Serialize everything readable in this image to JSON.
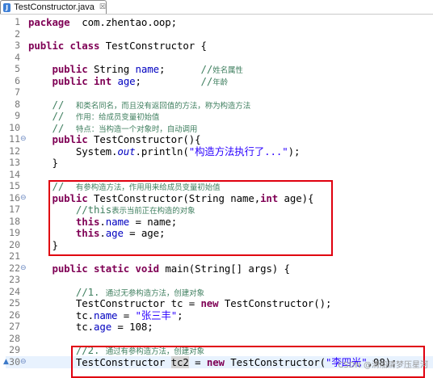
{
  "tab": {
    "title": "TestConstructor.java",
    "close_glyph": "☒"
  },
  "lines": [
    {
      "n": "1",
      "segs": [
        [
          "kw",
          "package"
        ],
        [
          "",
          "  com.zhentao.oop;"
        ]
      ]
    },
    {
      "n": "2",
      "segs": []
    },
    {
      "n": "3",
      "segs": [
        [
          "kw",
          "public"
        ],
        [
          "",
          ""
        ],
        [
          "kw",
          " class"
        ],
        [
          "",
          " TestConstructor {"
        ]
      ]
    },
    {
      "n": "4",
      "segs": []
    },
    {
      "n": "5",
      "segs": [
        [
          "",
          "    "
        ],
        [
          "kw",
          "public"
        ],
        [
          "",
          " String "
        ],
        [
          "field",
          "name"
        ],
        [
          "",
          ";      "
        ],
        [
          "cmm",
          "//"
        ],
        [
          "cm",
          "姓名属性"
        ]
      ]
    },
    {
      "n": "6",
      "segs": [
        [
          "",
          "    "
        ],
        [
          "kw",
          "public"
        ],
        [
          "kw",
          " int"
        ],
        [
          "",
          " "
        ],
        [
          "field",
          "age"
        ],
        [
          "",
          ";          "
        ],
        [
          "cmm",
          "//"
        ],
        [
          "cm",
          "年龄"
        ]
      ]
    },
    {
      "n": "7",
      "segs": []
    },
    {
      "n": "8",
      "segs": [
        [
          "",
          "    "
        ],
        [
          "cmm",
          "//  "
        ],
        [
          "cm",
          "和类名同名，而且没有返回值的方法，称为构造方法"
        ]
      ]
    },
    {
      "n": "9",
      "segs": [
        [
          "",
          "    "
        ],
        [
          "cmm",
          "//  "
        ],
        [
          "cm",
          "作用：给成员变量初始值"
        ]
      ]
    },
    {
      "n": "10",
      "segs": [
        [
          "",
          "    "
        ],
        [
          "cmm",
          "//  "
        ],
        [
          "cm",
          "特点：当构造一个对象时，自动调用"
        ]
      ]
    },
    {
      "n": "11",
      "fold": true,
      "segs": [
        [
          "",
          "    "
        ],
        [
          "kw",
          "public"
        ],
        [
          "",
          " TestConstructor(){"
        ]
      ]
    },
    {
      "n": "12",
      "segs": [
        [
          "",
          "        System."
        ],
        [
          "field it",
          "out"
        ],
        [
          "",
          ".println("
        ],
        [
          "str",
          "\"构造方法执行了...\""
        ],
        [
          "",
          ");"
        ]
      ]
    },
    {
      "n": "13",
      "segs": [
        [
          "",
          "    }"
        ]
      ]
    },
    {
      "n": "14",
      "segs": []
    },
    {
      "n": "15",
      "segs": [
        [
          "",
          "    "
        ],
        [
          "cmm",
          "//  "
        ],
        [
          "cm",
          "有参构造方法，作用用来给成员变量初始值"
        ]
      ]
    },
    {
      "n": "16",
      "fold": true,
      "segs": [
        [
          "",
          "    "
        ],
        [
          "kw",
          "public"
        ],
        [
          "",
          " TestConstructor(String name,"
        ],
        [
          "kw",
          "int"
        ],
        [
          "",
          " age){"
        ]
      ]
    },
    {
      "n": "17",
      "segs": [
        [
          "",
          "        "
        ],
        [
          "cmm",
          "//this"
        ],
        [
          "cm",
          "表示当前正在构造的对象"
        ]
      ]
    },
    {
      "n": "18",
      "segs": [
        [
          "",
          "        "
        ],
        [
          "kw",
          "this"
        ],
        [
          "",
          "."
        ],
        [
          "field",
          "name"
        ],
        [
          "",
          " = name;"
        ]
      ]
    },
    {
      "n": "19",
      "segs": [
        [
          "",
          "        "
        ],
        [
          "kw",
          "this"
        ],
        [
          "",
          "."
        ],
        [
          "field",
          "age"
        ],
        [
          "",
          " = age;"
        ]
      ]
    },
    {
      "n": "20",
      "segs": [
        [
          "",
          "    }"
        ]
      ]
    },
    {
      "n": "21",
      "segs": []
    },
    {
      "n": "22",
      "fold": true,
      "segs": [
        [
          "",
          "    "
        ],
        [
          "kw",
          "public"
        ],
        [
          "kw",
          " static"
        ],
        [
          "kw",
          " void"
        ],
        [
          "",
          " main(String[] args) {"
        ]
      ]
    },
    {
      "n": "23",
      "segs": []
    },
    {
      "n": "24",
      "segs": [
        [
          "",
          "        "
        ],
        [
          "cmm",
          "//1. "
        ],
        [
          "cm",
          "通过无参构造方法，创建对象"
        ]
      ]
    },
    {
      "n": "25",
      "segs": [
        [
          "",
          "        TestConstructor tc = "
        ],
        [
          "kw",
          "new"
        ],
        [
          "",
          " TestConstructor();"
        ]
      ]
    },
    {
      "n": "26",
      "segs": [
        [
          "",
          "        tc."
        ],
        [
          "field",
          "name"
        ],
        [
          "",
          " = "
        ],
        [
          "str",
          "\"张三丰\""
        ],
        [
          "",
          ";"
        ]
      ]
    },
    {
      "n": "27",
      "segs": [
        [
          "",
          "        tc."
        ],
        [
          "field",
          "age"
        ],
        [
          "",
          " = 108;"
        ]
      ]
    },
    {
      "n": "28",
      "segs": []
    },
    {
      "n": "29",
      "segs": [
        [
          "",
          "        "
        ],
        [
          "cmm",
          "//2. "
        ],
        [
          "cm",
          "通过有参构造方法，创建对象"
        ]
      ]
    },
    {
      "n": "30",
      "fold": true,
      "caret": true,
      "segs": [
        [
          "",
          "        TestConstructor "
        ],
        [
          "sel",
          "tc2"
        ],
        [
          "",
          " = "
        ],
        [
          "kw",
          "new"
        ],
        [
          "",
          " TestConstructor("
        ],
        [
          "str",
          "\"李四光\""
        ],
        [
          "",
          ",98);"
        ]
      ]
    }
  ],
  "watermark": "CSDN @清船清梦压星河"
}
